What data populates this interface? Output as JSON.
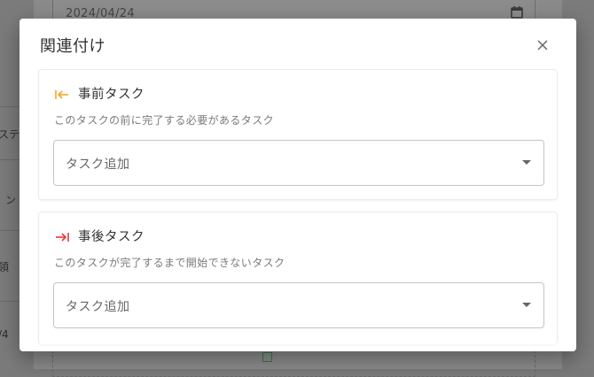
{
  "background": {
    "date_value": "2024/04/24",
    "left_fragments": [
      "ステ",
      "ン",
      "領",
      "/4"
    ]
  },
  "dialog": {
    "title": "関連付け",
    "close_icon": "close-icon",
    "predecessor": {
      "title": "事前タスク",
      "description": "このタスクの前に完了する必要があるタスク",
      "select_placeholder": "タスク追加",
      "icon": "arrow-left-bar-icon",
      "icon_color": "#f5a623"
    },
    "successor": {
      "title": "事後タスク",
      "description": "このタスクが完了するまで開始できないタスク",
      "select_placeholder": "タスク追加",
      "icon": "arrow-right-bar-icon",
      "icon_color": "#e53935"
    }
  }
}
